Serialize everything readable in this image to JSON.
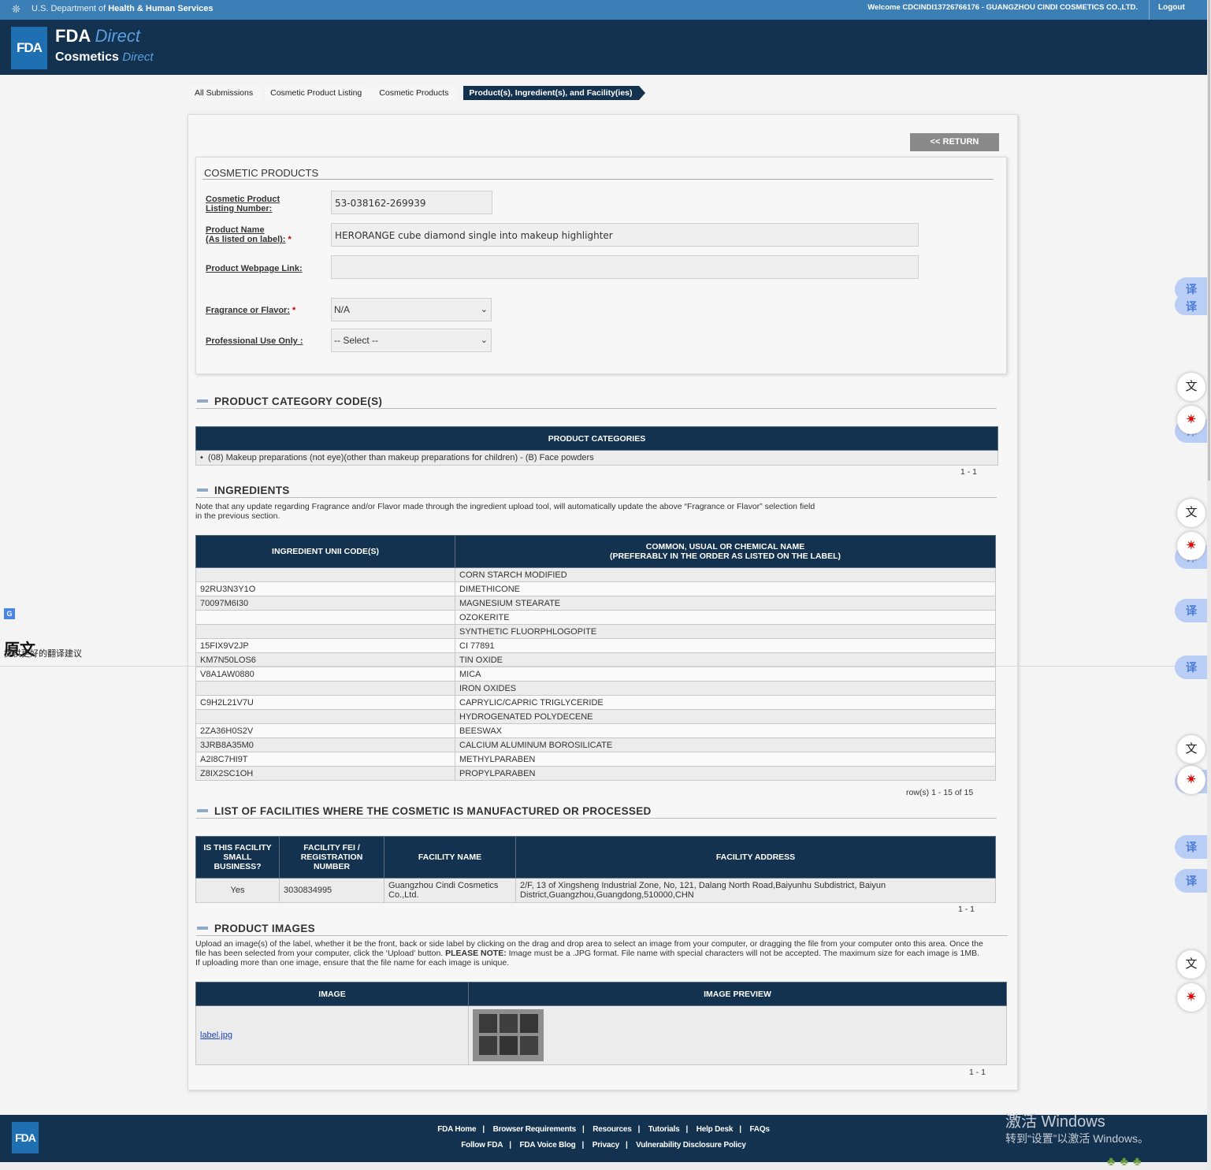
{
  "header": {
    "dept_prefix": "U.S. Department of",
    "dept_name": "Health & Human Services",
    "welcome": "Welcome CDCINDI13726766176 - GUANGZHOU CINDI COSMETICS CO.,LTD.",
    "logout": "Logout",
    "fda_logo": "FDA",
    "brand_line1_bold": "FDA",
    "brand_line1_italic": "Direct",
    "brand_line2_bold": "Cosmetics",
    "brand_line2_italic": "Direct"
  },
  "breadcrumbs": [
    "All Submissions",
    "Cosmetic Product Listing",
    "Cosmetic Products",
    "Product(s), Ingredient(s), and Facility(ies)"
  ],
  "return_button": "<< RETURN",
  "cosmetic_products": {
    "title": "COSMETIC PRODUCTS",
    "listing_number_label_1": "Cosmetic Product",
    "listing_number_label_2": "Listing Number:",
    "listing_number": "53-038162-269939",
    "product_name_label_1": "Product Name",
    "product_name_label_2": "(As listed on label):",
    "product_name": "HERORANGE cube diamond single into makeup highlighter",
    "webpage_label": "Product Webpage Link:",
    "webpage_value": "",
    "fragrance_label": "Fragrance or Flavor:",
    "fragrance_value": "N/A",
    "professional_label": "Professional Use Only :",
    "professional_value": "-- Select --",
    "required_mark": "*"
  },
  "categories": {
    "title": "PRODUCT CATEGORY CODE(S)",
    "header": "PRODUCT CATEGORIES",
    "items": [
      "(08) Makeup preparations (not eye)(other than makeup preparations for children) - (B) Face powders"
    ],
    "pager": "1 - 1"
  },
  "ingredients": {
    "title": "INGREDIENTS",
    "note_line1": "Note that any update regarding Fragrance and/or Flavor made through the ingredient upload tool, will automatically update the above “Fragrance or Flavor” selection field",
    "note_line2": "in the previous section.",
    "col1": "INGREDIENT UNII CODE(S)",
    "col2_line1": "COMMON, USUAL OR CHEMICAL NAME",
    "col2_line2": "(PREFERABLY IN THE ORDER AS LISTED ON THE LABEL)",
    "rows": [
      {
        "code": "",
        "name": "CORN STARCH MODIFIED"
      },
      {
        "code": "92RU3N3Y1O",
        "name": "DIMETHICONE"
      },
      {
        "code": "70097M6I30",
        "name": "MAGNESIUM STEARATE"
      },
      {
        "code": "",
        "name": "OZOKERITE"
      },
      {
        "code": "",
        "name": "SYNTHETIC FLUORPHLOGOPITE"
      },
      {
        "code": "15FIX9V2JP",
        "name": "CI 77891"
      },
      {
        "code": "KM7N50LOS6",
        "name": "TIN OXIDE"
      },
      {
        "code": "V8A1AW0880",
        "name": "MICA"
      },
      {
        "code": "",
        "name": "IRON OXIDES"
      },
      {
        "code": "C9H2L21V7U",
        "name": "CAPRYLIC/CAPRIC TRIGLYCERIDE"
      },
      {
        "code": "",
        "name": "HYDROGENATED POLYDECENE"
      },
      {
        "code": "2ZA36H0S2V",
        "name": "BEESWAX"
      },
      {
        "code": "3JRB8A35M0",
        "name": "CALCIUM ALUMINUM BOROSILICATE"
      },
      {
        "code": "A2I8C7HI9T",
        "name": "METHYLPARABEN"
      },
      {
        "code": "Z8IX2SC1OH",
        "name": "PROPYLPARABEN"
      }
    ],
    "pager": "row(s) 1 - 15 of 15"
  },
  "facilities": {
    "title": "LIST OF FACILITIES WHERE THE COSMETIC IS MANUFACTURED OR PROCESSED",
    "col1_l1": "IS THIS FACILITY",
    "col1_l2": "SMALL",
    "col1_l3": "BUSINESS?",
    "col2_l1": "FACILITY FEI /",
    "col2_l2": "REGISTRATION",
    "col2_l3": "NUMBER",
    "col3": "FACILITY NAME",
    "col4": "FACILITY ADDRESS",
    "small_business": "Yes",
    "fei": "3030834995",
    "name_l1": "Guangzhou Cindi Cosmetics",
    "name_l2": "Co.,Ltd.",
    "address_l1": "2/F, 13 of Xingsheng Industrial Zone, No, 121, Dalang North Road,Baiyunhu Subdistrict, Baiyun",
    "address_l2": "District,Guangzhou,Guangdong,510000,CHN",
    "pager": "1 - 1"
  },
  "images": {
    "title": "PRODUCT IMAGES",
    "note_l1": "Upload an image(s) of the label, whether it be the front, back or side label by clicking on the drag and drop area to select an image from your computer, or dragging the file from your computer onto this area. Once the",
    "note_l2a": "file has been selected from your computer, click the ‘Upload’ button. ",
    "note_l2b": "PLEASE NOTE:",
    "note_l2c": " Image must be a .JPG format. File name with special characters will not be accepted. The maximum size for each image is 1MB.",
    "note_l3": "If uploading more than one image, ensure that the file name for each image is unique.",
    "col1": "IMAGE",
    "col2": "IMAGE PREVIEW",
    "file": "label.jpg",
    "pager": "1 - 1"
  },
  "footer": {
    "logo": "FDA",
    "row1": [
      "FDA Home",
      "Browser Requirements",
      "Resources",
      "Tutorials",
      "Help Desk",
      "FAQs"
    ],
    "row2": [
      "Follow FDA",
      "FDA Voice Blog",
      "Privacy",
      "Vulnerability Disclosure Policy"
    ],
    "separator": "|"
  },
  "overlay": {
    "original_text": "原文",
    "suggest_text": "提供更好的翻译建议",
    "translate_glyph": "译",
    "win_line1": "激活 Windows",
    "win_line2": "转到“设置”以激活 Windows。"
  }
}
